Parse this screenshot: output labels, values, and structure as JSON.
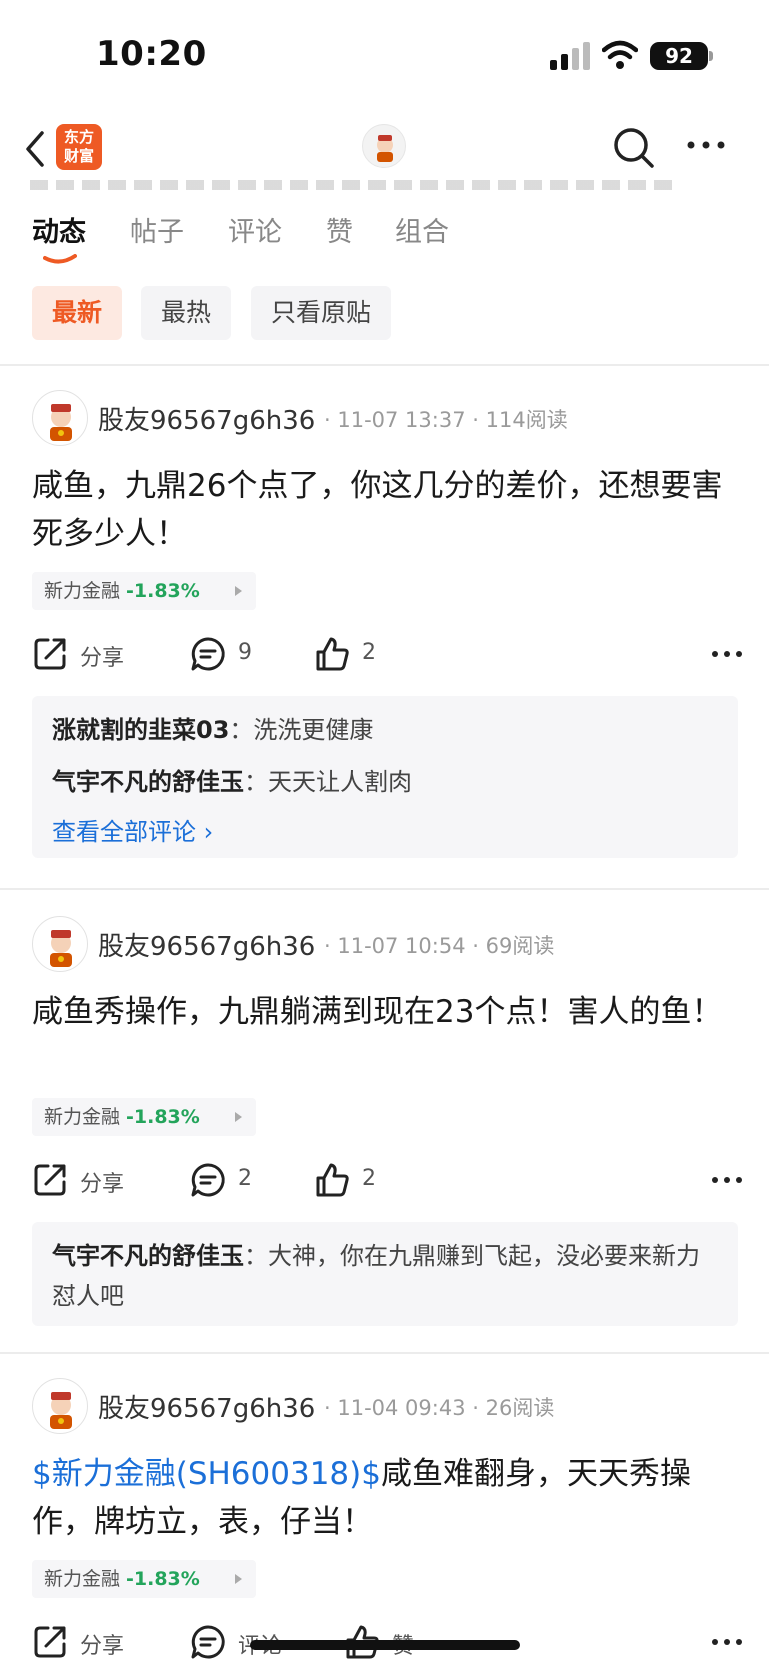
{
  "status_bar": {
    "time": "10:20",
    "battery": "92"
  },
  "nav": {
    "logo_text": "东方\n财富"
  },
  "tabs": [
    {
      "label": "动态"
    },
    {
      "label": "帖子"
    },
    {
      "label": "评论"
    },
    {
      "label": "赞"
    },
    {
      "label": "组合"
    }
  ],
  "filters": [
    {
      "label": "最新"
    },
    {
      "label": "最热"
    },
    {
      "label": "只看原贴"
    }
  ],
  "posts": [
    {
      "author": "股友96567g6h36",
      "time": "11-07 13:37",
      "reads": "114阅读",
      "body": "咸鱼，九鼎26个点了，你这几分的差价，还想要害死多少人！",
      "stock_name": "新力金融",
      "stock_change": "-1.83%",
      "share_label": "分享",
      "comment_count": "9",
      "like_count": "2",
      "comments": [
        {
          "user": "涨就割的韭菜03",
          "sep": "：",
          "text": "洗洗更健康"
        },
        {
          "user": "气宇不凡的舒佳玉",
          "sep": "：",
          "text": "天天让人割肉"
        }
      ],
      "view_all": "查看全部评论"
    },
    {
      "author": "股友96567g6h36",
      "time": "11-07 10:54",
      "reads": "69阅读",
      "body": "咸鱼秀操作，九鼎躺满到现在23个点！害人的鱼！",
      "stock_name": "新力金融",
      "stock_change": "-1.83%",
      "share_label": "分享",
      "comment_count": "2",
      "like_count": "2",
      "comments": [
        {
          "user": "气宇不凡的舒佳玉",
          "sep": "：",
          "text": "大神，你在九鼎赚到飞起，没必要来新力怼人吧"
        }
      ]
    },
    {
      "author": "股友96567g6h36",
      "time": "11-04 09:43",
      "reads": "26阅读",
      "body_link": "$新力金融(SH600318)$",
      "body": "咸鱼难翻身，天天秀操作，牌坊立，表，仔当！",
      "stock_name": "新力金融",
      "stock_change": "-1.83%",
      "share_label": "分享",
      "comment_label": "评论",
      "like_label": "赞"
    }
  ],
  "colors": {
    "accent": "#ee5a24",
    "link": "#1b6fd8",
    "down": "#23a45b"
  },
  "icons": [
    "back-icon",
    "search-icon",
    "more-icon",
    "share-icon",
    "comment-icon",
    "like-icon",
    "signal-icon",
    "wifi-icon"
  ]
}
